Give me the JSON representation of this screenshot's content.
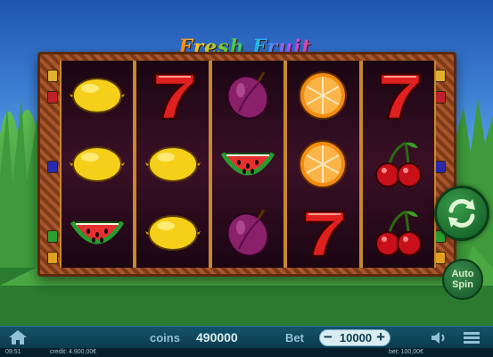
{
  "game": {
    "title": "Fresh Fruit"
  },
  "reels": [
    [
      "lemon",
      "lemon",
      "watermelon"
    ],
    [
      "seven",
      "lemon",
      "lemon"
    ],
    [
      "plum",
      "watermelon",
      "plum"
    ],
    [
      "orange",
      "orange",
      "seven"
    ],
    [
      "seven",
      "cherries",
      "cherries"
    ]
  ],
  "controls": {
    "spin_icon": "spin-arrows-icon",
    "auto_spin_line1": "Auto",
    "auto_spin_line2": "Spin"
  },
  "bottom_bar": {
    "home_icon": "home-icon",
    "coins_label": "coins",
    "coins_value": "490000",
    "bet_label": "Bet",
    "bet_minus": "−",
    "bet_value": "10000",
    "bet_plus": "+",
    "sound_icon": "speaker-icon",
    "menu_icon": "hamburger-menu-icon"
  },
  "status_bar": {
    "time": "09:51",
    "credit": "credit: 4.900,00€",
    "bet": "bet: 100,00€"
  },
  "colors": {
    "spin_green": "#0d5520",
    "bar_teal": "#13546a",
    "frame_wood": "#8a4420"
  }
}
